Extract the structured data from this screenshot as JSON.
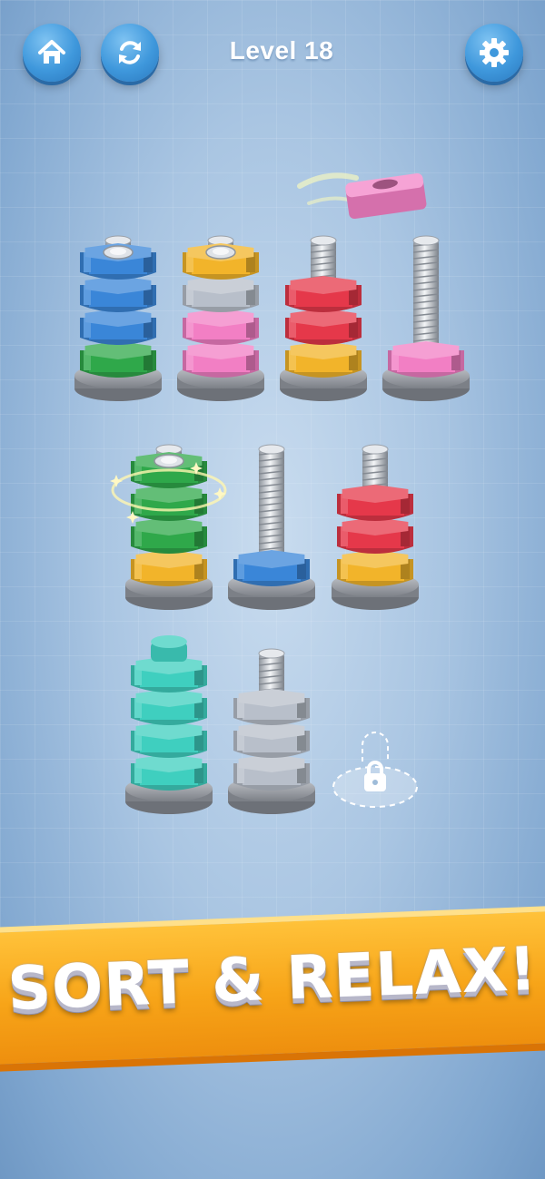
{
  "header": {
    "title": "Level 18",
    "home_icon": "home-icon",
    "restart_icon": "restart-icon",
    "settings_icon": "gear-icon"
  },
  "banner": {
    "text": "SORT & RELAX!"
  },
  "colors": {
    "blue": "#3a86d8",
    "green": "#2fa84a",
    "yellow": "#f2b42a",
    "silver": "#b8bfca",
    "pink": "#f27fc4",
    "red": "#e5384a",
    "teal": "#3fcfbf"
  },
  "flying_nut": "pink",
  "bolts": [
    {
      "id": "bolt-1",
      "nuts": [
        "green",
        "blue",
        "blue",
        "blue"
      ],
      "locked": false
    },
    {
      "id": "bolt-2",
      "nuts": [
        "pink",
        "pink",
        "silver",
        "yellow"
      ],
      "locked": false
    },
    {
      "id": "bolt-3",
      "nuts": [
        "yellow",
        "red",
        "red"
      ],
      "locked": false
    },
    {
      "id": "bolt-4",
      "nuts": [
        "pink"
      ],
      "locked": false
    },
    {
      "id": "bolt-5",
      "nuts": [
        "yellow",
        "green",
        "green",
        "green"
      ],
      "locked": false,
      "highlight": true
    },
    {
      "id": "bolt-6",
      "nuts": [
        "blue"
      ],
      "locked": false
    },
    {
      "id": "bolt-7",
      "nuts": [
        "yellow",
        "red",
        "red"
      ],
      "locked": false
    },
    {
      "id": "bolt-8",
      "nuts": [
        "teal",
        "teal",
        "teal",
        "teal"
      ],
      "locked": false,
      "capped": true
    },
    {
      "id": "bolt-9",
      "nuts": [
        "silver",
        "silver",
        "silver"
      ],
      "locked": false
    },
    {
      "id": "bolt-10",
      "nuts": [],
      "locked": true
    }
  ]
}
